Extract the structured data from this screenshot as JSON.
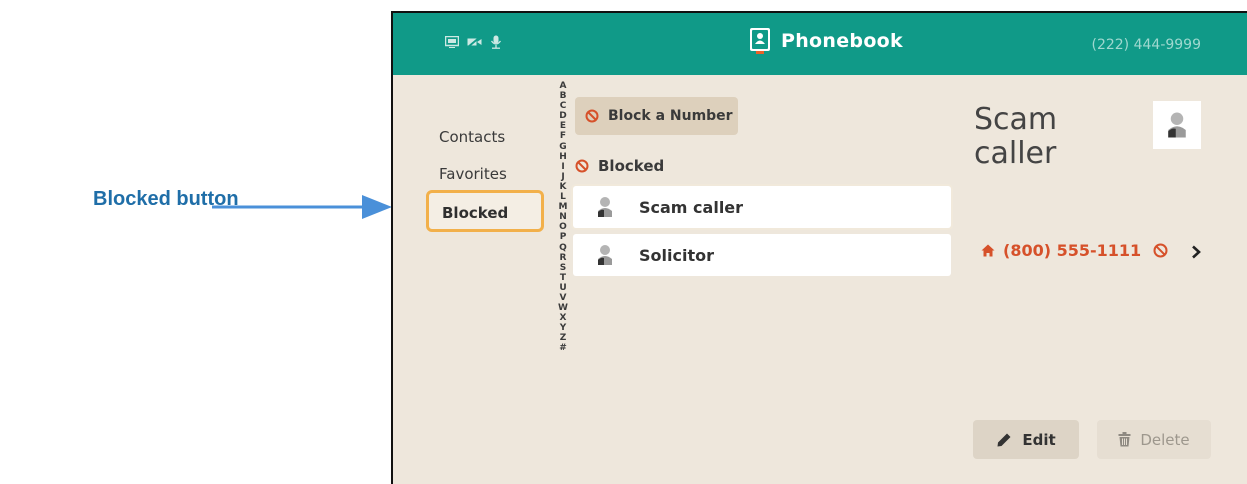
{
  "annotation": {
    "label": "Blocked button"
  },
  "header": {
    "title": "Phonebook",
    "phone_number": "(222) 444-9999",
    "status_icons": [
      "monitor-icon",
      "video-off-icon",
      "microphone-icon"
    ]
  },
  "nav": {
    "items": [
      {
        "label": "Contacts",
        "selected": false
      },
      {
        "label": "Favorites",
        "selected": false
      },
      {
        "label": "Blocked",
        "selected": true
      }
    ]
  },
  "alphabet": [
    "A",
    "B",
    "C",
    "D",
    "E",
    "F",
    "G",
    "H",
    "I",
    "J",
    "K",
    "L",
    "M",
    "N",
    "O",
    "P",
    "Q",
    "R",
    "S",
    "T",
    "U",
    "V",
    "W",
    "X",
    "Y",
    "Z",
    "#"
  ],
  "list": {
    "block_button_label": "Block a Number",
    "section_header": "Blocked",
    "items": [
      {
        "name": "Scam caller",
        "selected": true
      },
      {
        "name": "Solicitor",
        "selected": false
      }
    ]
  },
  "detail": {
    "name": "Scam caller",
    "phone": "(800) 555-1111",
    "phone_type_icon": "home-icon",
    "blocked_icon": "block-icon",
    "edit_label": "Edit",
    "delete_label": "Delete"
  },
  "colors": {
    "header_bg": "#109a88",
    "panel_bg": "#eee7dc",
    "selection_border": "#f2b04a",
    "block_red": "#d6512a",
    "annotation_blue": "#1f6ea8"
  }
}
